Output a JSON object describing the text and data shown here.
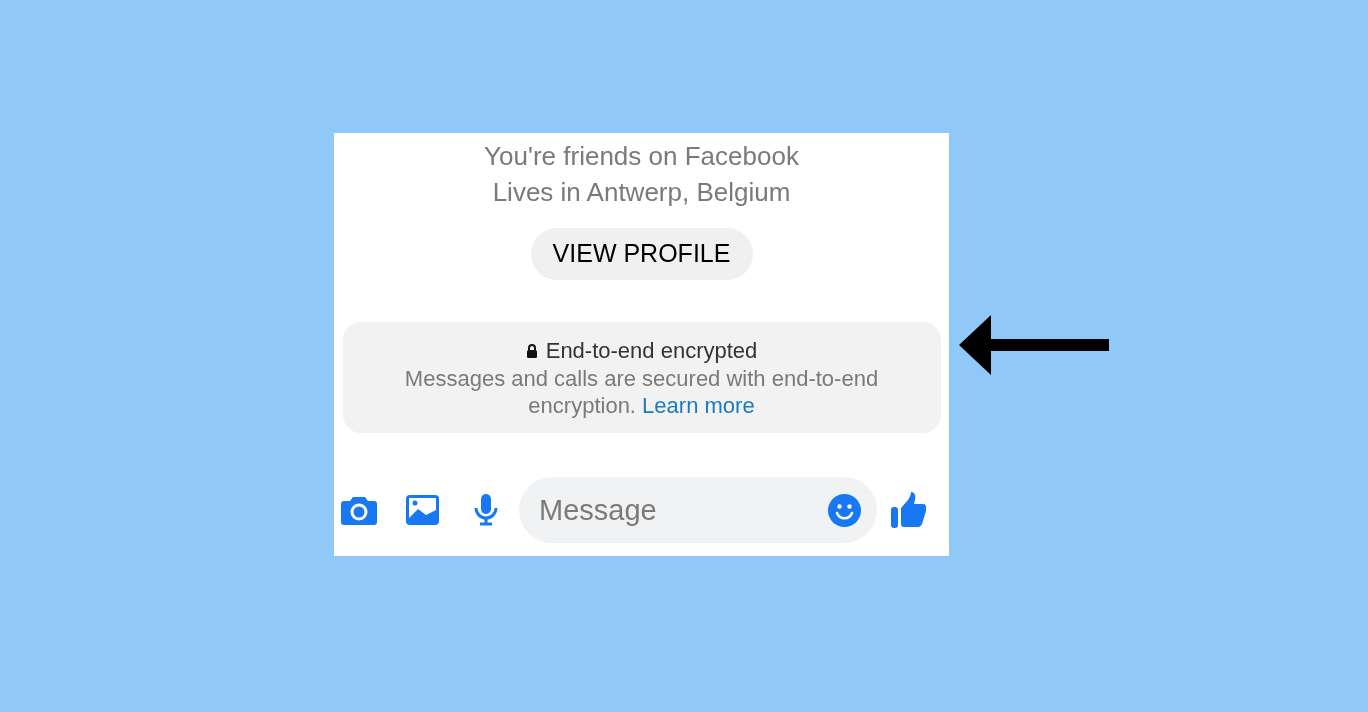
{
  "profile_lines": [
    "You're friends on Facebook",
    "Lives in Antwerp, Belgium"
  ],
  "view_profile_button": "VIEW PROFILE",
  "encryption_notice": {
    "title": "End-to-end encrypted",
    "description": "Messages and calls are secured with end-to-end encryption.",
    "link": "Learn more"
  },
  "composer": {
    "placeholder": "Message"
  }
}
